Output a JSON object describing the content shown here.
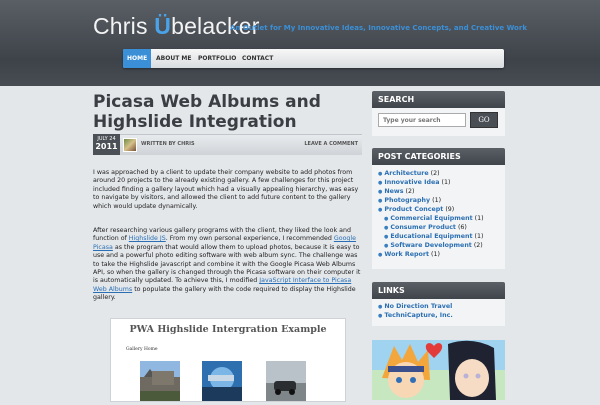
{
  "header": {
    "site_title_first": "Chris ",
    "site_title_umlaut": "Ü",
    "site_title_rest": "belacker",
    "tagline": "An Outlet for My Innovative Ideas, Innovative Concepts, and Creative Work"
  },
  "nav": {
    "items": [
      "HOME",
      "ABOUT ME",
      "PORTFOLIO",
      "CONTACT"
    ],
    "active": "HOME"
  },
  "post": {
    "title": "Picasa Web Albums and Highslide Integration",
    "date_month_day": "JULY 24",
    "date_year": "2011",
    "written_by": "WRITTEN BY CHRIS",
    "comment_link": "LEAVE A COMMENT",
    "p1": "I was approached by a client to update their company website to add photos from around 20 projects to the already existing gallery. A few challenges for this project included finding a gallery layout which had a visually appealing hierarchy, was easy to navigate by visitors, and allowed the client to add future content to the gallery which would update dynamically.",
    "p2_a": "After researching various gallery programs with the client, they liked the look and function of ",
    "p2_link1": "Highslide JS",
    "p2_b": ". From my own personal experience, I recommended ",
    "p2_link2": "Google Picasa",
    "p2_c": " as the program that would allow them to upload photos, because it is easy to use and a powerful photo editing software with web album sync. The challenge was to take the Highslide javascript and combine it with the Google Picasa Web Albums API, so when the gallery is changed through the Picasa software on their computer it is automatically updated. To achieve this, I modified ",
    "p2_link3": "JavaScript Interface to Picasa Web Albums",
    "p2_d": " to populate the gallery with the code required to display the Highslide gallery.",
    "gallery_title": "PWA Highslide Intergration Example",
    "gallery_home": "Gallery Home"
  },
  "sidebar": {
    "search": {
      "title": "SEARCH",
      "placeholder": "Type your search",
      "button": "GO"
    },
    "categories": {
      "title": "POST CATEGORIES",
      "items": [
        {
          "label": "Architecture",
          "count": "(2)",
          "level": 0
        },
        {
          "label": "Innovative Idea",
          "count": "(1)",
          "level": 0
        },
        {
          "label": "News",
          "count": "(2)",
          "level": 0
        },
        {
          "label": "Photography",
          "count": "(1)",
          "level": 0
        },
        {
          "label": "Product Concept",
          "count": "(9)",
          "level": 0
        },
        {
          "label": "Commercial Equipment",
          "count": "(1)",
          "level": 1
        },
        {
          "label": "Consumer Product",
          "count": "(6)",
          "level": 1
        },
        {
          "label": "Educational Equipment",
          "count": "(1)",
          "level": 1
        },
        {
          "label": "Software Development",
          "count": "(2)",
          "level": 1
        },
        {
          "label": "Work Report",
          "count": "(1)",
          "level": 0
        }
      ]
    },
    "links": {
      "title": "LINKS",
      "items": [
        "No Direction Travel",
        "TechniCapture, Inc."
      ]
    }
  },
  "colors": {
    "accent": "#3a8fd6",
    "link": "#2a6fb3",
    "widget_header": "#4a4f55"
  }
}
